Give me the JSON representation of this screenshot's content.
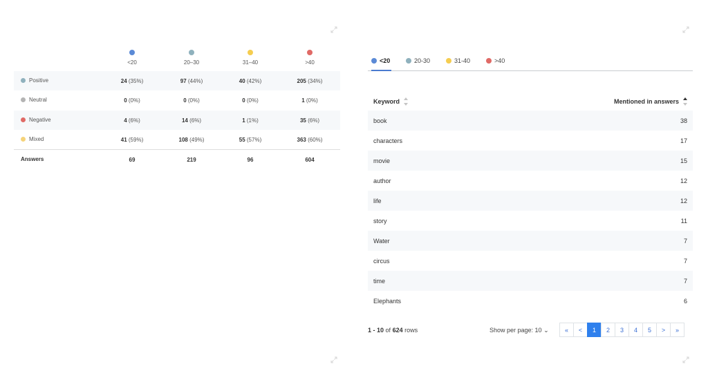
{
  "colors": {
    "lt20": "#5b8ad6",
    "20_30": "#8fb1bd",
    "31_40": "#f5cd50",
    "gt40": "#e06a66",
    "positive": "#8fb1bd",
    "neutral": "#b4b4b4",
    "negative": "#e06a66",
    "mixed": "#f5d37a",
    "accent": "#2f80ed"
  },
  "sentiment": {
    "groups": [
      {
        "label": "<20",
        "color": "#5b8ad6"
      },
      {
        "label": "20–30",
        "color": "#8fb1bd"
      },
      {
        "label": "31–40",
        "color": "#f5cd50"
      },
      {
        "label": ">40",
        "color": "#e06a66"
      }
    ],
    "rows": [
      {
        "label": "Positive",
        "color": "#8fb1bd",
        "cells": [
          {
            "n": "24",
            "p": " (35%)"
          },
          {
            "n": "97",
            "p": " (44%)"
          },
          {
            "n": "40",
            "p": " (42%)"
          },
          {
            "n": "205",
            "p": " (34%)"
          }
        ]
      },
      {
        "label": "Neutral",
        "color": "#b4b4b4",
        "cells": [
          {
            "n": "0",
            "p": " (0%)"
          },
          {
            "n": "0",
            "p": " (0%)"
          },
          {
            "n": "0",
            "p": " (0%)"
          },
          {
            "n": "1",
            "p": " (0%)"
          }
        ]
      },
      {
        "label": "Negative",
        "color": "#e06a66",
        "cells": [
          {
            "n": "4",
            "p": " (6%)"
          },
          {
            "n": "14",
            "p": " (6%)"
          },
          {
            "n": "1",
            "p": " (1%)"
          },
          {
            "n": "35",
            "p": " (6%)"
          }
        ]
      },
      {
        "label": "Mixed",
        "color": "#f5d37a",
        "cells": [
          {
            "n": "41",
            "p": " (59%)"
          },
          {
            "n": "108",
            "p": " (49%)"
          },
          {
            "n": "55",
            "p": " (57%)"
          },
          {
            "n": "363",
            "p": " (60%)"
          }
        ]
      }
    ],
    "answers": {
      "label": "Answers",
      "values": [
        "69",
        "219",
        "96",
        "604"
      ]
    }
  },
  "tabs": [
    {
      "label": "<20",
      "color": "#5b8ad6",
      "active": true
    },
    {
      "label": "20-30",
      "color": "#8fb1bd",
      "active": false
    },
    {
      "label": "31-40",
      "color": "#f5cd50",
      "active": false
    },
    {
      "label": ">40",
      "color": "#e06a66",
      "active": false
    }
  ],
  "keywords": {
    "header": {
      "keyword": "Keyword",
      "mentions": "Mentioned in answers"
    },
    "rows": [
      {
        "keyword": "book",
        "count": "38"
      },
      {
        "keyword": "characters",
        "count": "17"
      },
      {
        "keyword": "movie",
        "count": "15"
      },
      {
        "keyword": "author",
        "count": "12"
      },
      {
        "keyword": "life",
        "count": "12"
      },
      {
        "keyword": "story",
        "count": "11"
      },
      {
        "keyword": "Water",
        "count": "7"
      },
      {
        "keyword": "circus",
        "count": "7"
      },
      {
        "keyword": "time",
        "count": "7"
      },
      {
        "keyword": "Elephants",
        "count": "6"
      }
    ]
  },
  "footer": {
    "range": "1 - 10",
    "of": "of",
    "total": "624",
    "rows_word": "rows",
    "per_page_label": "Show per page: 10",
    "chevron": "⌄"
  },
  "pagination": {
    "first": "«",
    "prev": "<",
    "pages": [
      "1",
      "2",
      "3",
      "4",
      "5"
    ],
    "active_page": "1",
    "next": ">",
    "last": "»"
  },
  "icons": [
    "expand-icon",
    "sort-icon",
    "sort-desc-icon",
    "chevron-down-icon"
  ]
}
